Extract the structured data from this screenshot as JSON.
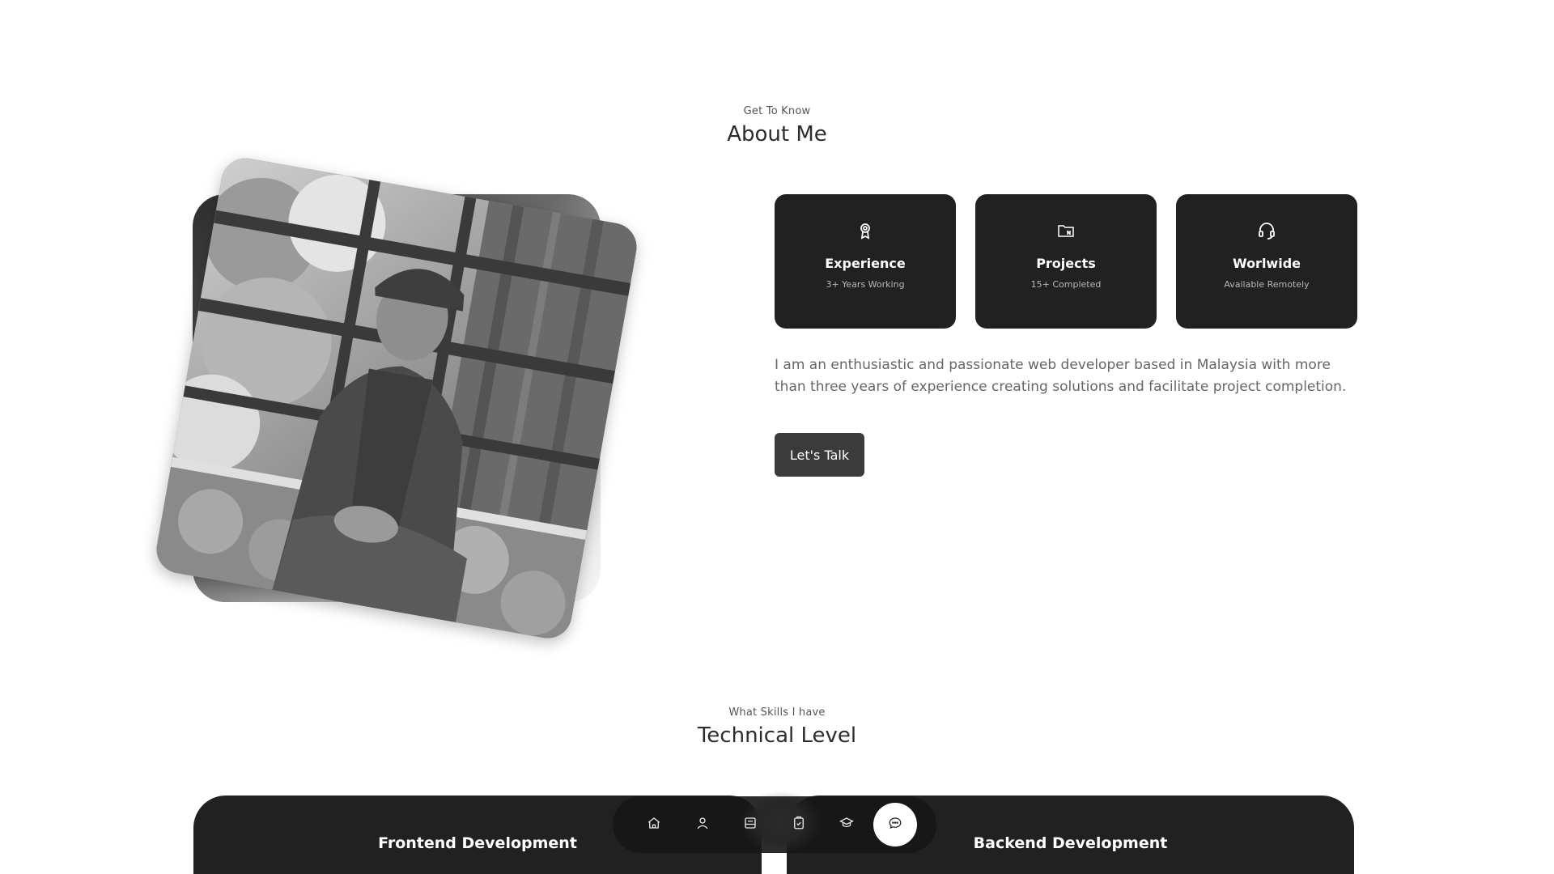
{
  "about": {
    "subtitle": "Get To Know",
    "title": "About Me",
    "cards": [
      {
        "title": "Experience",
        "sub": "3+ Years Working",
        "icon": "award-icon"
      },
      {
        "title": "Projects",
        "sub": "15+ Completed",
        "icon": "folder-icon"
      },
      {
        "title": "Worlwide",
        "sub": "Available Remotely",
        "icon": "headset-icon"
      }
    ],
    "text": "I am an enthusiastic and passionate web developer based in Malaysia with more than three years of experience creating solutions and facilitate project completion.",
    "button": "Let's Talk"
  },
  "skills": {
    "subtitle": "What Skills I have",
    "title": "Technical Level",
    "frontend_title": "Frontend Development",
    "backend_title": "Backend Development"
  },
  "nav": {
    "items": [
      {
        "icon": "home-icon"
      },
      {
        "icon": "user-icon"
      },
      {
        "icon": "book-icon"
      },
      {
        "icon": "clipboard-check-icon"
      },
      {
        "icon": "graduation-cap-icon"
      },
      {
        "icon": "chat-icon",
        "active": true
      }
    ]
  },
  "colors": {
    "card_bg": "#212121",
    "button_bg": "#3b3b3b",
    "text_muted": "#666666"
  }
}
